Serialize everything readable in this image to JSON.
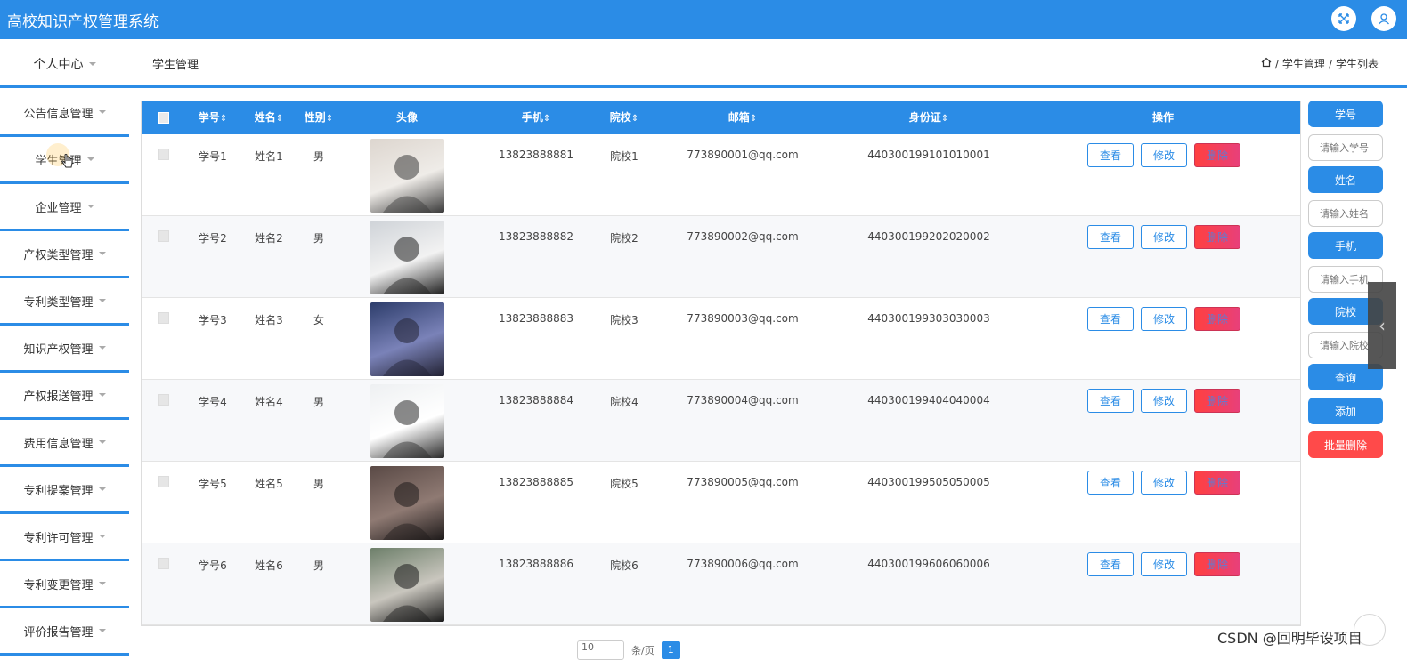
{
  "app": {
    "title": "高校知识产权管理系统"
  },
  "header": {
    "fullscreen_icon": "expand-icon",
    "user_icon": "user-icon"
  },
  "nav": {
    "personal_center": "个人中心",
    "page_title": "学生管理",
    "breadcrumb": {
      "home_icon": "home-icon",
      "sep1": "/",
      "level1": "学生管理",
      "sep2": "/",
      "level2": "学生列表"
    }
  },
  "sidebar": {
    "items": [
      {
        "label": "公告信息管理"
      },
      {
        "label": "学生管理"
      },
      {
        "label": "企业管理"
      },
      {
        "label": "产权类型管理"
      },
      {
        "label": "专利类型管理"
      },
      {
        "label": "知识产权管理"
      },
      {
        "label": "产权报送管理"
      },
      {
        "label": "费用信息管理"
      },
      {
        "label": "专利提案管理"
      },
      {
        "label": "专利许可管理"
      },
      {
        "label": "专利变更管理"
      },
      {
        "label": "评价报告管理"
      }
    ]
  },
  "table": {
    "headers": [
      "学号",
      "姓名",
      "性别",
      "头像",
      "手机",
      "院校",
      "邮箱",
      "身份证",
      "操作"
    ],
    "sort_icon": "sort-icon",
    "rows": [
      {
        "id": "学号1",
        "name": "姓名1",
        "gender": "男",
        "phone": "13823888881",
        "school": "院校1",
        "email": "773890001@qq.com",
        "idcard": "440300199101010001"
      },
      {
        "id": "学号2",
        "name": "姓名2",
        "gender": "男",
        "phone": "13823888882",
        "school": "院校2",
        "email": "773890002@qq.com",
        "idcard": "440300199202020002"
      },
      {
        "id": "学号3",
        "name": "姓名3",
        "gender": "女",
        "phone": "13823888883",
        "school": "院校3",
        "email": "773890003@qq.com",
        "idcard": "440300199303030003"
      },
      {
        "id": "学号4",
        "name": "姓名4",
        "gender": "男",
        "phone": "13823888884",
        "school": "院校4",
        "email": "773890004@qq.com",
        "idcard": "440300199404040004"
      },
      {
        "id": "学号5",
        "name": "姓名5",
        "gender": "男",
        "phone": "13823888885",
        "school": "院校5",
        "email": "773890005@qq.com",
        "idcard": "440300199505050005"
      },
      {
        "id": "学号6",
        "name": "姓名6",
        "gender": "男",
        "phone": "13823888886",
        "school": "院校6",
        "email": "773890006@qq.com",
        "idcard": "440300199606060006"
      }
    ],
    "actions": {
      "view": "查看",
      "edit": "修改",
      "delete": "删除"
    }
  },
  "search_panel": {
    "fields": [
      {
        "label": "学号",
        "placeholder": "请输入学号"
      },
      {
        "label": "姓名",
        "placeholder": "请输入姓名"
      },
      {
        "label": "手机",
        "placeholder": "请输入手机"
      },
      {
        "label": "院校",
        "placeholder": "请输入院校"
      }
    ],
    "query_button": "查询",
    "add_button": "添加",
    "batch_delete_button": "批量删除"
  },
  "pagination": {
    "page_size": "10",
    "page_size_suffix": "条/页",
    "current_page": "1"
  },
  "watermark": "CSDN @回明毕设项目",
  "colors": {
    "primary": "#2b8ce6",
    "danger": "#ff4a4a"
  }
}
